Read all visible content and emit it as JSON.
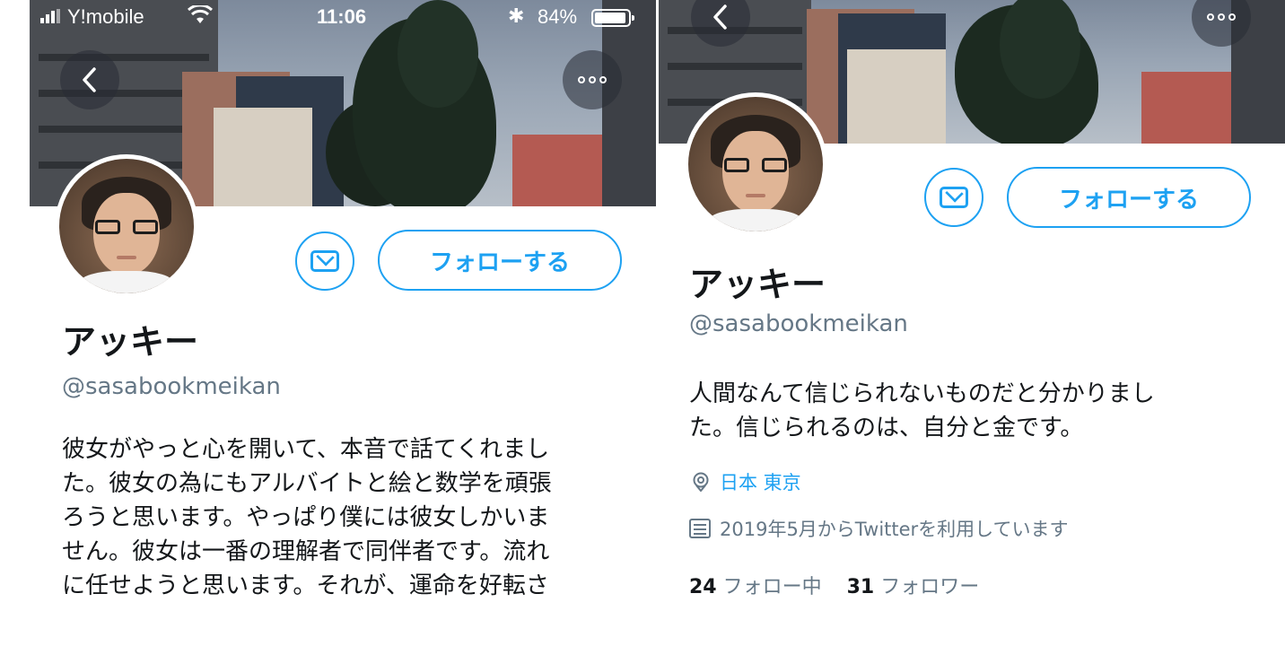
{
  "colors": {
    "accent": "#1da1f2",
    "text": "#14171a",
    "secondary": "#657786"
  },
  "status_bar": {
    "carrier": "Y!mobile",
    "time": "11:06",
    "battery_percent": "84%",
    "bluetooth_glyph": "✱"
  },
  "icons": [
    "back-chevron-icon",
    "more-options-icon",
    "envelope-icon",
    "location-pin-icon",
    "calendar-icon",
    "signal-icon",
    "wifi-icon",
    "battery-icon",
    "bluetooth-icon"
  ],
  "left_profile": {
    "follow_label": "フォローする",
    "display_name": "アッキー",
    "handle": "@sasabookmeikan",
    "bio_lines": [
      "彼女がやっと心を開いて、本音で話てくれまし",
      "た。彼女の為にもアルバイトと絵と数学を頑張",
      "ろうと思います。やっぱり僕には彼女しかいま",
      "せん。彼女は一番の理解者で同伴者です。流れ",
      "に任せようと思います。それが、運命を好転さ"
    ]
  },
  "right_profile": {
    "follow_label": "フォローする",
    "display_name": "アッキー",
    "handle": "@sasabookmeikan",
    "bio_lines": [
      "人間なんて信じられないものだと分かりまし",
      "た。信じられるのは、自分と金です。"
    ],
    "location": "日本 東京",
    "joined": "2019年5月からTwitterを利用しています",
    "following_count": "24",
    "following_label": "フォロー中",
    "followers_count": "31",
    "followers_label": "フォロワー"
  }
}
